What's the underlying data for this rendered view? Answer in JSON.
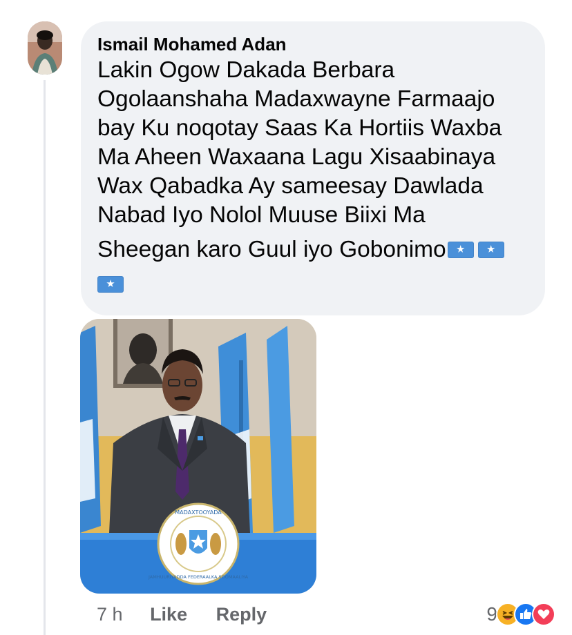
{
  "comment": {
    "author": "Ismail Mohamed Adan",
    "lines": [
      "Lakin Ogow Dakada Berbara",
      "Ogolaanshaha Madaxwayne Farmaajo",
      "bay Ku noqotay Saas Ka Hortiis Waxba",
      "Ma Aheen Waxaana Lagu Xisaabinaya",
      "Wax Qabadka Ay sameesay Dawlada",
      "Nabad Iyo Nolol Muuse Biixi Ma",
      "Sheegan karo Guul iyo Gobonimo"
    ],
    "flag_icon": "somalia-flag-emoji",
    "flag_count": 3
  },
  "attachment": {
    "seal_text_top": "MADAXTOOYADA",
    "seal_text_bottom": "JAMHUURIYADDA FEDERAALKA SOOMAALIYA"
  },
  "footer": {
    "time": "7 h",
    "like_label": "Like",
    "reply_label": "Reply",
    "reaction_count": "9",
    "reactions": [
      "haha-icon",
      "like-icon",
      "love-icon"
    ]
  },
  "colors": {
    "bubble": "#f0f2f5",
    "meta_text": "#65676b",
    "like_blue": "#1877f2",
    "love_red": "#f33e58",
    "haha_yellow": "#f7b125"
  }
}
